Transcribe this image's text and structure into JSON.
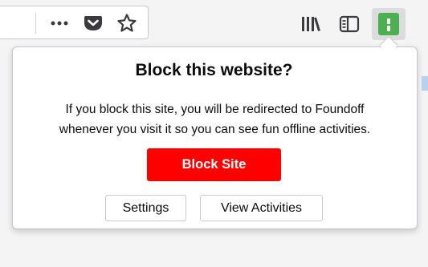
{
  "toolbar": {
    "icons": [
      "more-options-icon",
      "pocket-icon",
      "bookmark-star-icon",
      "library-icon",
      "sidebar-icon",
      "block-site-extension-icon"
    ],
    "accent_color": "#4caf50"
  },
  "popup": {
    "title": "Block this website?",
    "description_line1": "If you block this site, you will be redirected to Foundoff",
    "description_line2": "whenever you visit it so you can see fun offline activities.",
    "block_button_label": "Block Site",
    "settings_button_label": "Settings",
    "view_activities_button_label": "View Activities",
    "block_button_color": "#ff0000"
  }
}
